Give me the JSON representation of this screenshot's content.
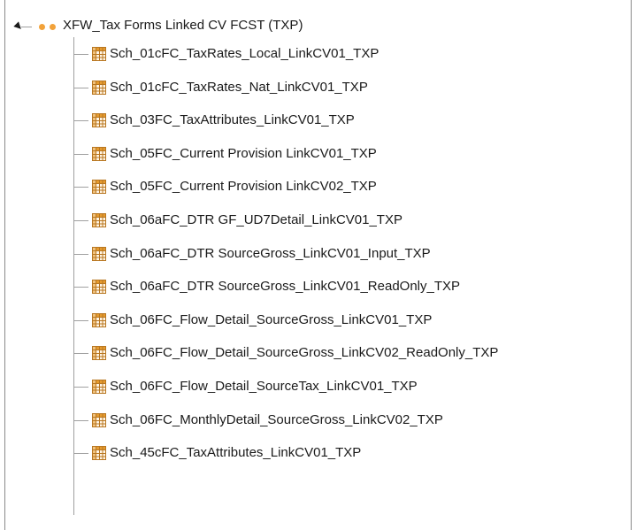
{
  "tree": {
    "root": {
      "label": "XFW_Tax Forms Linked CV FCST (TXP)",
      "icon": "two-dots-icon",
      "dot_color": "#f2a23a"
    },
    "items": [
      {
        "label": "Sch_01cFC_TaxRates_Local_LinkCV01_TXP",
        "icon": "table-grid-icon"
      },
      {
        "label": "Sch_01cFC_TaxRates_Nat_LinkCV01_TXP",
        "icon": "table-grid-icon"
      },
      {
        "label": "Sch_03FC_TaxAttributes_LinkCV01_TXP",
        "icon": "table-grid-icon"
      },
      {
        "label": "Sch_05FC_Current Provision LinkCV01_TXP",
        "icon": "table-grid-icon"
      },
      {
        "label": "Sch_05FC_Current Provision LinkCV02_TXP",
        "icon": "table-grid-icon"
      },
      {
        "label": "Sch_06aFC_DTR GF_UD7Detail_LinkCV01_TXP",
        "icon": "table-grid-icon"
      },
      {
        "label": "Sch_06aFC_DTR SourceGross_LinkCV01_Input_TXP",
        "icon": "table-grid-icon"
      },
      {
        "label": "Sch_06aFC_DTR SourceGross_LinkCV01_ReadOnly_TXP",
        "icon": "table-grid-icon"
      },
      {
        "label": "Sch_06FC_Flow_Detail_SourceGross_LinkCV01_TXP",
        "icon": "table-grid-icon"
      },
      {
        "label": "Sch_06FC_Flow_Detail_SourceGross_LinkCV02_ReadOnly_TXP",
        "icon": "table-grid-icon"
      },
      {
        "label": "Sch_06FC_Flow_Detail_SourceTax_LinkCV01_TXP",
        "icon": "table-grid-icon"
      },
      {
        "label": "Sch_06FC_MonthlyDetail_SourceGross_LinkCV02_TXP",
        "icon": "table-grid-icon"
      },
      {
        "label": "Sch_45cFC_TaxAttributes_LinkCV01_TXP",
        "icon": "table-grid-icon"
      }
    ]
  }
}
